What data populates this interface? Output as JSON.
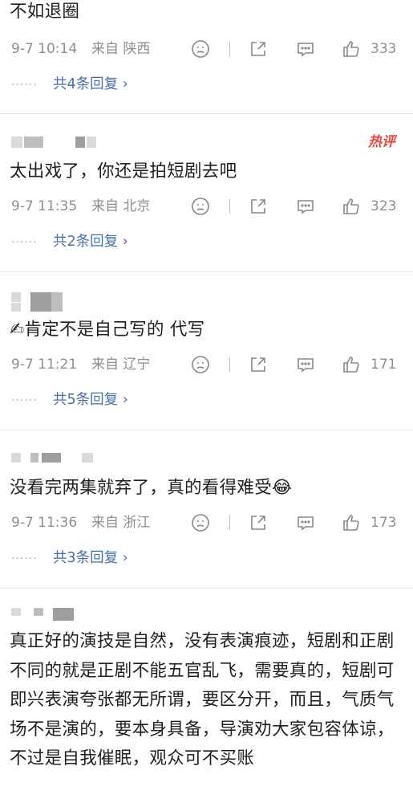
{
  "top_partial": {
    "text": "不如退圈",
    "time": "9-7 10:14",
    "location": "来自 陕西",
    "likes": "333",
    "replies": "共4条回复 ›"
  },
  "comments": [
    {
      "badge": "热评",
      "text": "太出戏了，你还是拍短剧去吧",
      "time": "9-7 11:35",
      "location": "来自 北京",
      "likes": "323",
      "replies": "共2条回复 ›"
    },
    {
      "text": "✍肯定不是自己写的   代写",
      "time": "9-7 11:21",
      "location": "来自 辽宁",
      "likes": "171",
      "replies": "共5条回复 ›"
    },
    {
      "text": "没看完两集就弃了，真的看得难受😂",
      "time": "9-7 11:36",
      "location": "来自 浙江",
      "likes": "173",
      "replies": "共3条回复 ›"
    },
    {
      "text": "真正好的演技是自然，没有表演痕迹，短剧和正剧不同的就是正剧不能五官乱飞，需要真的，短剧可即兴表演夸张都无所谓，要区分开，而且，气质气场不是演的，要本身具备，导演劝大家包容体谅，不过是自我催眠，观众可不买账"
    }
  ],
  "reply_dots": "······",
  "icons": [
    "dislike-face-icon",
    "share-icon",
    "comment-icon",
    "like-thumb-icon"
  ],
  "colors": {
    "link": "#4a6ea9",
    "meta": "#8e8e8e",
    "hot": "#e9483f"
  }
}
